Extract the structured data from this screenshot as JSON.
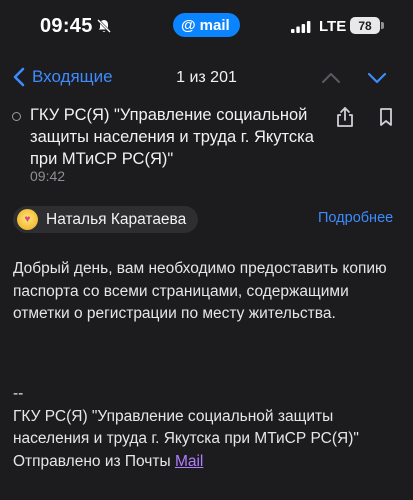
{
  "status_bar": {
    "time": "09:45",
    "app_pill": "mail",
    "network": "LTE",
    "battery": "78"
  },
  "nav": {
    "back_label": "Входящие",
    "counter": "1 из 201"
  },
  "message": {
    "subject": "ГКУ РС(Я) \"Управление социальной защиты населения и труда г. Якутска при МТиСР РС(Я)\"",
    "time": "09:42",
    "sender": "Наталья Каратаева",
    "details_label": "Подробнее",
    "body": "Добрый день, вам необходимо предоставить копию паспорта со всеми страницами, содержащими отметки о регистрации по месту жительства.",
    "signature": {
      "dashes": "--",
      "org": "ГКУ РС(Я) \"Управление социальной защиты населения и труда г. Якутска при МТиСР РС(Я)\"",
      "sent_from": "Отправлено из Почты ",
      "link_label": "Mail"
    }
  },
  "colors": {
    "background": "#1c1c1e",
    "accent": "#3d8bff",
    "link": "#b17dff"
  }
}
